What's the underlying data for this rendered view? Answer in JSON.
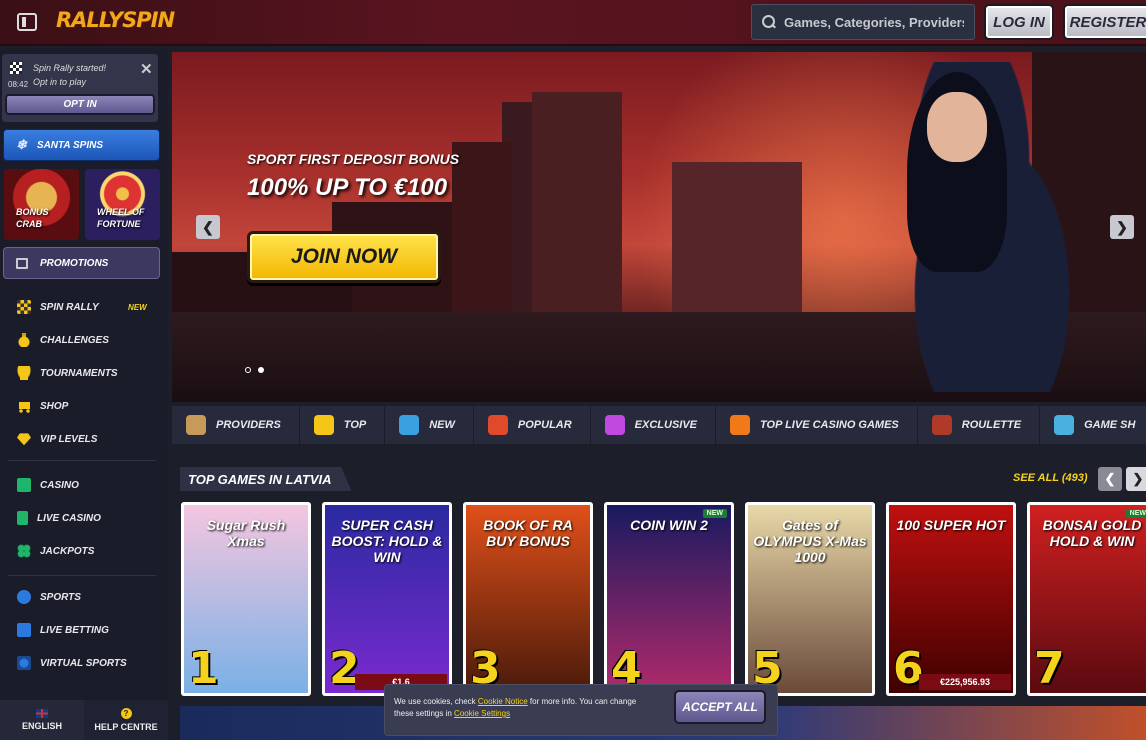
{
  "header": {
    "logo": "RALLYSPIN",
    "search_placeholder": "Games, Categories, Providers",
    "login_label": "LOG IN",
    "register_label": "REGISTER"
  },
  "sidebar": {
    "rally": {
      "title": "Spin Rally started!",
      "subtitle": "Opt in to play",
      "time": "08:42",
      "optin_label": "OPT IN"
    },
    "santa_label": "SANTA SPINS",
    "tiles": [
      {
        "line1": "BONUS",
        "line2": "CRAB"
      },
      {
        "line1": "WHEEL OF",
        "line2": "FORTUNE"
      }
    ],
    "promotions_label": "PROMOTIONS",
    "nav_group_1": [
      {
        "label": "SPIN RALLY",
        "badge": "NEW",
        "icon": "flag-icon"
      },
      {
        "label": "CHALLENGES",
        "icon": "medal-icon"
      },
      {
        "label": "TOURNAMENTS",
        "icon": "trophy-icon"
      },
      {
        "label": "SHOP",
        "icon": "cart-icon"
      },
      {
        "label": "VIP LEVELS",
        "icon": "diamond-icon"
      }
    ],
    "nav_group_2": [
      {
        "label": "CASINO",
        "icon": "slot-icon"
      },
      {
        "label": "LIVE CASINO",
        "icon": "card-icon"
      },
      {
        "label": "JACKPOTS",
        "icon": "clover-icon"
      }
    ],
    "nav_group_3": [
      {
        "label": "SPORTS",
        "icon": "ball-icon"
      },
      {
        "label": "LIVE BETTING",
        "icon": "live-icon"
      },
      {
        "label": "VIRTUAL SPORTS",
        "icon": "virtual-icon"
      }
    ],
    "footer": {
      "language": "ENGLISH",
      "help": "HELP CENTRE",
      "help_icon": "?"
    }
  },
  "banner": {
    "subtitle": "SPORT FIRST DEPOSIT BONUS",
    "title": "100% UP TO €100",
    "cta": "JOIN NOW",
    "prev": "❮",
    "next": "❯",
    "slides": 2,
    "active_slide": 2
  },
  "categories": [
    {
      "label": "PROVIDERS",
      "color": "#c89a5a"
    },
    {
      "label": "TOP",
      "color": "#f5c518"
    },
    {
      "label": "NEW",
      "color": "#3aa0e0"
    },
    {
      "label": "POPULAR",
      "color": "#e04a2a"
    },
    {
      "label": "EXCLUSIVE",
      "color": "#c04ae0"
    },
    {
      "label": "TOP LIVE CASINO GAMES",
      "color": "#f07a1a"
    },
    {
      "label": "ROULETTE",
      "color": "#b03a2a"
    },
    {
      "label": "GAME SH",
      "color": "#4ab0e0"
    }
  ],
  "top_games": {
    "heading": "TOP GAMES IN LATVIA",
    "see_all": "SEE ALL (493)",
    "prev": "❮",
    "next": "❯",
    "games": [
      {
        "rank": "1",
        "name": "Sugar Rush Xmas",
        "bg1": "#f4c6df",
        "bg2": "#7ab0e6",
        "jackpot": "",
        "new": ""
      },
      {
        "rank": "2",
        "name": "SUPER CASH BOOST: HOLD & WIN",
        "bg1": "#2a2aa0",
        "bg2": "#7a2ad0",
        "jackpot": "€1,6",
        "new": ""
      },
      {
        "rank": "3",
        "name": "BOOK OF RA BUY BONUS",
        "bg1": "#e0501a",
        "bg2": "#4a1a0a",
        "jackpot": "",
        "new": ""
      },
      {
        "rank": "4",
        "name": "COIN WIN 2",
        "bg1": "#1a1a60",
        "bg2": "#b02a6a",
        "jackpot": "",
        "new": "NEW"
      },
      {
        "rank": "5",
        "name": "Gates of OLYMPUS X-Mas 1000",
        "bg1": "#e8d8a8",
        "bg2": "#6a4a3a",
        "jackpot": "",
        "new": ""
      },
      {
        "rank": "6",
        "name": "100 SUPER HOT",
        "bg1": "#c01010",
        "bg2": "#400000",
        "jackpot": "€225,956.93",
        "new": ""
      },
      {
        "rank": "7",
        "name": "BONSAI GOLD HOLD & WIN",
        "bg1": "#d02020",
        "bg2": "#5a0a10",
        "jackpot": "",
        "new": "NEW"
      }
    ]
  },
  "cookie": {
    "text_1": "We use cookies, check ",
    "link_1": "Cookie Notice",
    "text_2": " for more info. You can change these settings in ",
    "link_2": "Cookie Settings",
    "accept": "ACCEPT ALL"
  }
}
